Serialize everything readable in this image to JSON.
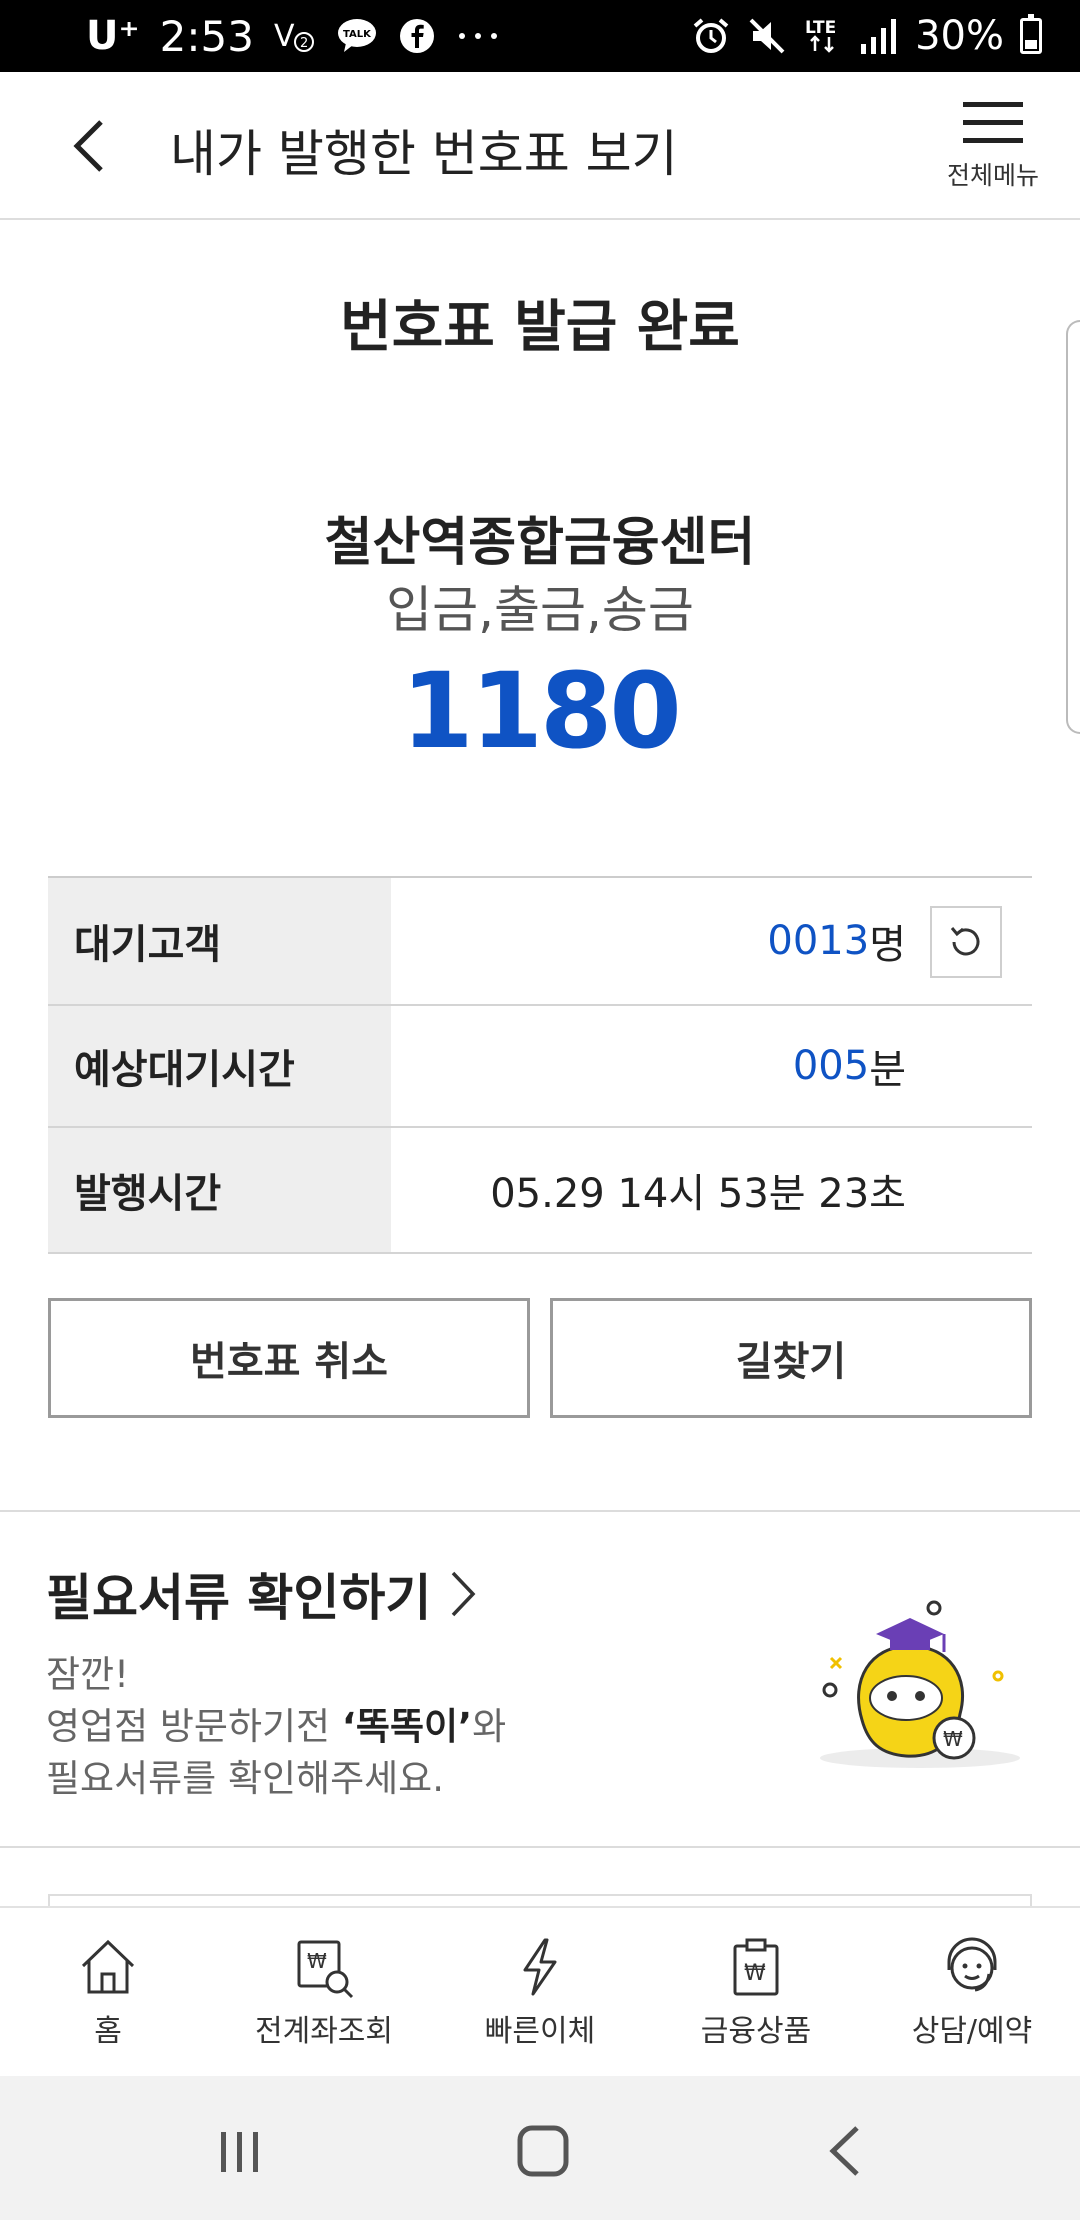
{
  "status_bar": {
    "carrier": "U⁺",
    "time": "2:53",
    "network": "LTE",
    "battery": "30%"
  },
  "header": {
    "title": "내가 발행한 번호표 보기",
    "menu_label": "전체메뉴"
  },
  "ticket": {
    "complete_title": "번호표 발급 완료",
    "branch": "철산역종합금융센터",
    "service": "입금,출금,송금",
    "number": "1180"
  },
  "info": {
    "waiting_label": "대기고객",
    "waiting_count": "0013",
    "waiting_unit": "명",
    "eta_label": "예상대기시간",
    "eta_value": "005",
    "eta_unit": "분",
    "issued_label": "발행시간",
    "issued_value": "05.29 14시 53분 23초"
  },
  "actions": {
    "cancel_label": "번호표 취소",
    "route_label": "길찾기"
  },
  "docs": {
    "title": "필요서류 확인하기",
    "line1": "잠깐!",
    "line2_pre": "영업점 방문하기전 ",
    "line2_bold": "‘똑똑이’",
    "line2_post": "와",
    "line3": "필요서류를 확인해주세요."
  },
  "bottom_nav": {
    "home": "홈",
    "accounts": "전계좌조회",
    "transfer": "빠른이체",
    "products": "금융상품",
    "consult": "상담/예약"
  },
  "colors": {
    "accent_blue": "#0f53c4",
    "mascot_yellow": "#f5d417",
    "mascot_purple": "#6a3fb5"
  }
}
